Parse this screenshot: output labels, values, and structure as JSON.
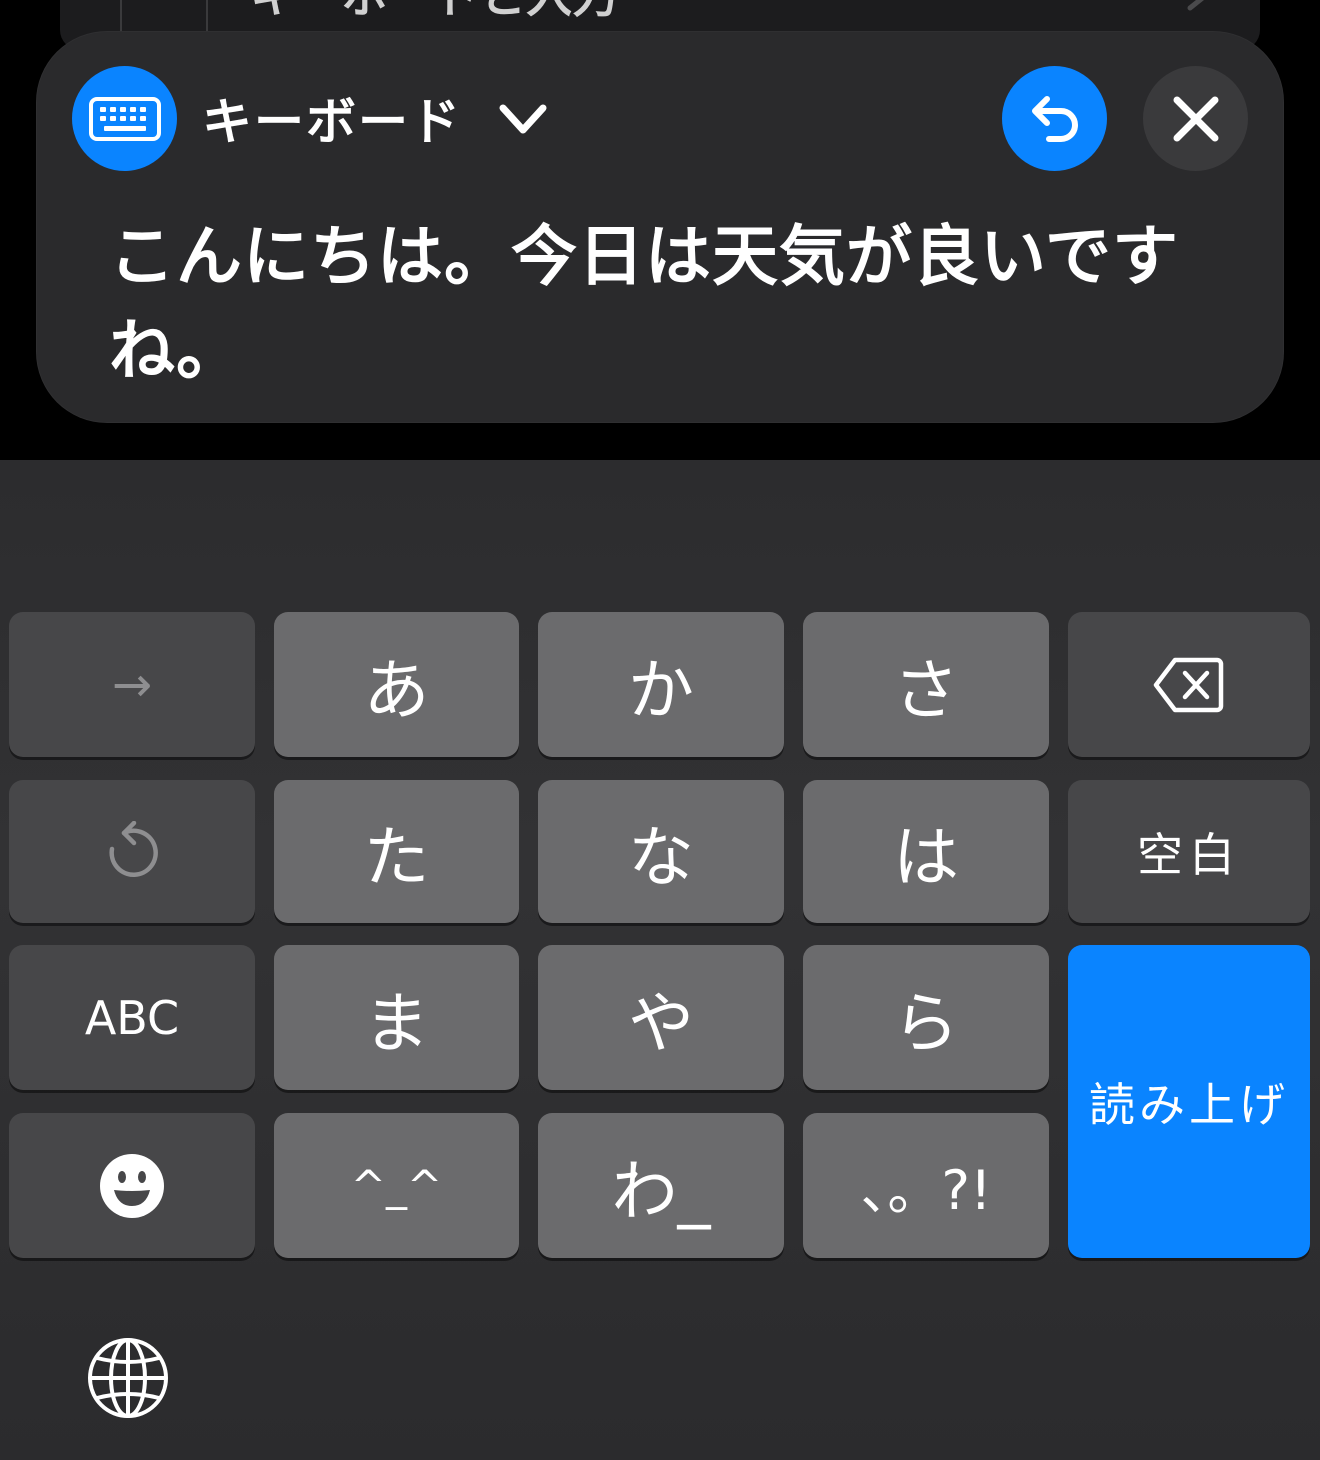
{
  "background": {
    "row_label": "キーボードと入力"
  },
  "panel": {
    "title": "キーボード",
    "text": "こんにちは。今日は天気が良いですね。",
    "icons": {
      "badge": "keyboard-icon",
      "dropdown": "chevron-down-icon",
      "undo": "undo-icon",
      "close": "close-icon"
    },
    "accent_color": "#0a84ff"
  },
  "keyboard": {
    "row1": {
      "next": "→",
      "a": "あ",
      "ka": "か",
      "sa": "さ",
      "delete_icon": "delete-backward-icon"
    },
    "row2": {
      "undo_icon": "rotate-left-icon",
      "ta": "た",
      "na": "な",
      "ha": "は",
      "space": "空白"
    },
    "row3": {
      "abc": "ABC",
      "ma": "ま",
      "ya": "や",
      "ra": "ら",
      "enter": "読み上げ"
    },
    "row4": {
      "emoji_icon": "emoji-icon",
      "kaomoji": "^_^",
      "wa": "わ_",
      "punct": "、。?!"
    },
    "globe_icon": "globe-icon"
  }
}
